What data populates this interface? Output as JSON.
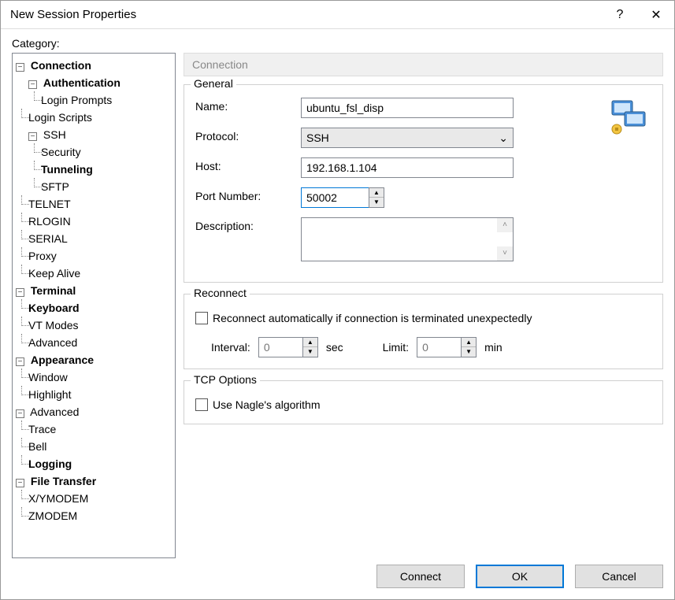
{
  "window": {
    "title": "New Session Properties",
    "help": "?",
    "close": "✕"
  },
  "category_label": "Category:",
  "tree": {
    "connection": "Connection",
    "authentication": "Authentication",
    "login_prompts": "Login Prompts",
    "login_scripts": "Login Scripts",
    "ssh": "SSH",
    "security": "Security",
    "tunneling": "Tunneling",
    "sftp": "SFTP",
    "telnet": "TELNET",
    "rlogin": "RLOGIN",
    "serial": "SERIAL",
    "proxy": "Proxy",
    "keep_alive": "Keep Alive",
    "terminal": "Terminal",
    "keyboard": "Keyboard",
    "vt_modes": "VT Modes",
    "advanced_t": "Advanced",
    "appearance": "Appearance",
    "window": "Window",
    "highlight": "Highlight",
    "advanced": "Advanced",
    "trace": "Trace",
    "bell": "Bell",
    "logging": "Logging",
    "file_transfer": "File Transfer",
    "xymodem": "X/YMODEM",
    "zmodem": "ZMODEM"
  },
  "section": {
    "title": "Connection"
  },
  "general": {
    "title": "General",
    "name_label": "Name:",
    "name_value": "ubuntu_fsl_disp",
    "protocol_label": "Protocol:",
    "protocol_value": "SSH",
    "host_label": "Host:",
    "host_value": "192.168.1.104",
    "port_label": "Port Number:",
    "port_value": "50002",
    "description_label": "Description:",
    "description_value": ""
  },
  "reconnect": {
    "title": "Reconnect",
    "checkbox_label": "Reconnect automatically if connection is terminated unexpectedly",
    "interval_label": "Interval:",
    "interval_value": "0",
    "interval_unit": "sec",
    "limit_label": "Limit:",
    "limit_value": "0",
    "limit_unit": "min"
  },
  "tcp": {
    "title": "TCP Options",
    "nagle_label": "Use Nagle's algorithm"
  },
  "buttons": {
    "connect": "Connect",
    "ok": "OK",
    "cancel": "Cancel"
  }
}
